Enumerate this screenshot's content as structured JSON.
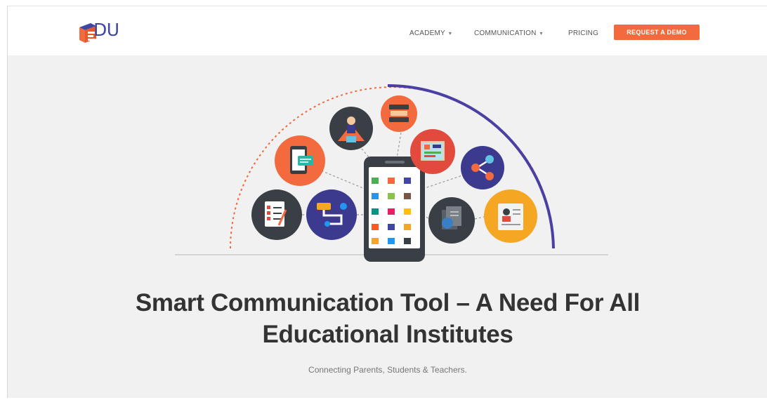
{
  "brand": {
    "logo_text": "DU"
  },
  "nav": {
    "academy_label": "ACADEMY",
    "communication_label": "COMMUNICATION",
    "pricing_label": "PRICING",
    "cta_label": "REQUEST A DEMO"
  },
  "hero": {
    "headline_line1": "Smart Communication Tool – A Need For All",
    "headline_line2": "Educational Institutes",
    "subtitle": "Connecting Parents, Students & Teachers."
  },
  "colors": {
    "brand_blue": "#3f46a4",
    "accent_orange": "#f26a3e",
    "arc_purple": "#4a3fa3",
    "circle_dark": "#3a3f45",
    "circle_navy": "#3c3a8f",
    "circle_red": "#e24a3d",
    "circle_yellow": "#f5a623"
  },
  "illustration_icons": [
    "checklist-icon",
    "route-map-icon",
    "chat-phone-icon",
    "teacher-icon",
    "books-icon",
    "noticeboard-icon",
    "share-icon",
    "documents-icon",
    "profile-card-icon"
  ]
}
